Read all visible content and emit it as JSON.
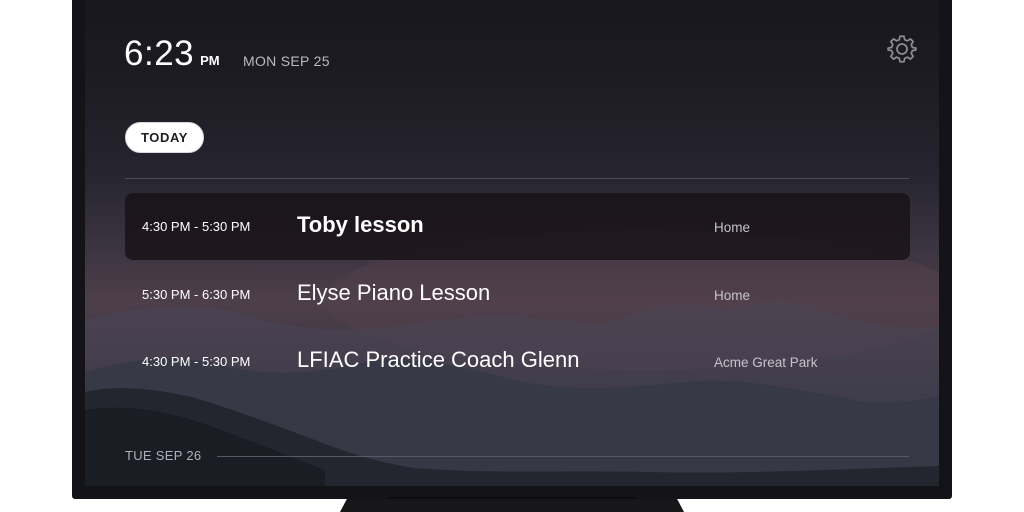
{
  "header": {
    "time": "6:23",
    "ampm": "PM",
    "date": "MON SEP 25",
    "settings_icon": "gear-icon"
  },
  "today_label": "TODAY",
  "events": [
    {
      "time": "4:30 PM - 5:30 PM",
      "title": "Toby lesson",
      "location": "Home"
    },
    {
      "time": "5:30 PM - 6:30 PM",
      "title": "Elyse Piano Lesson",
      "location": "Home"
    },
    {
      "time": "4:30 PM - 5:30 PM",
      "title": "LFIAC Practice Coach Glenn",
      "location": "Acme Great Park"
    }
  ],
  "next_day_label": "TUE SEP 26",
  "colors": {
    "frame": "#141418",
    "selected_row": "#161014",
    "pill_bg": "#ffffff"
  }
}
